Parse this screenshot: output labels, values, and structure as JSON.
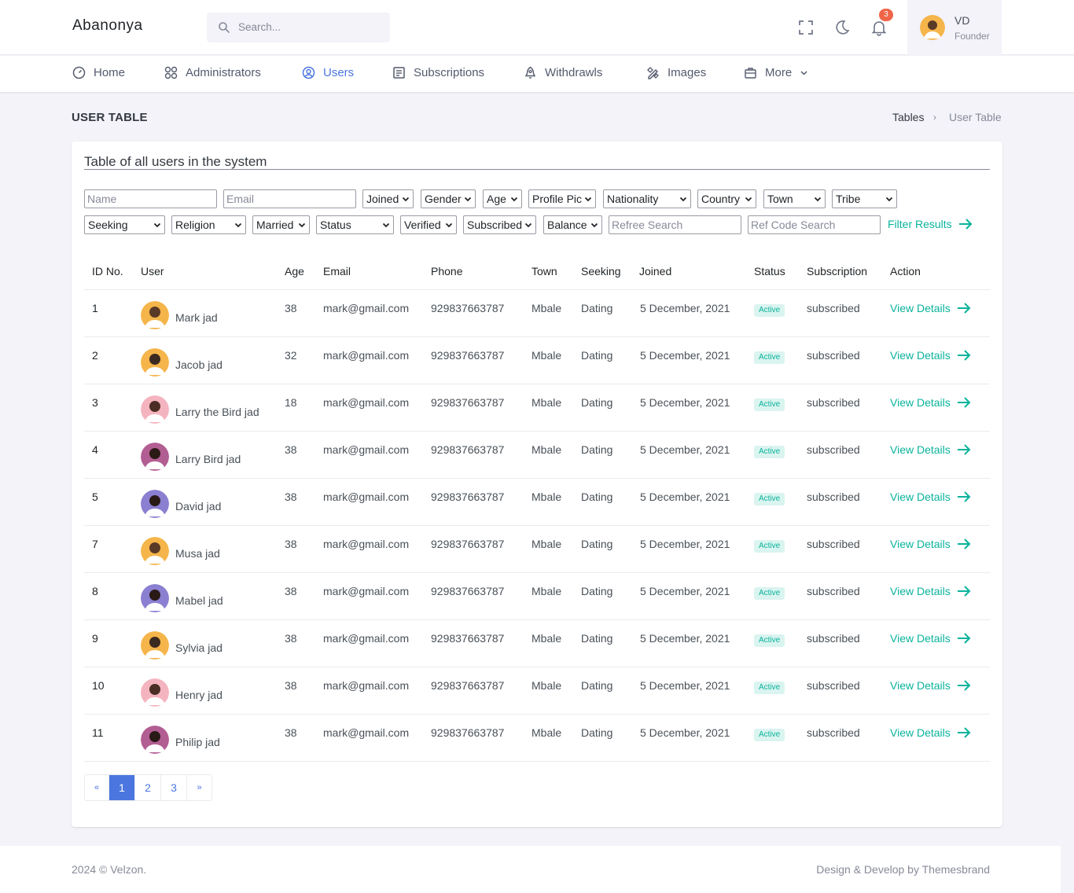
{
  "header": {
    "brand": "Abanonya",
    "search_placeholder": "Search...",
    "notifications_count": "3",
    "user": {
      "initials": "VD",
      "role": "Founder"
    }
  },
  "nav": [
    {
      "label": "Home",
      "icon": "dashboard-icon"
    },
    {
      "label": "Administrators",
      "icon": "apps-icon"
    },
    {
      "label": "Users",
      "icon": "user-circle-icon",
      "active": true
    },
    {
      "label": "Subscriptions",
      "icon": "file-list-icon"
    },
    {
      "label": "Withdrawls",
      "icon": "rocket-icon"
    },
    {
      "label": "Images",
      "icon": "pencil-ruler-icon"
    },
    {
      "label": "More",
      "icon": "briefcase-icon"
    }
  ],
  "page": {
    "title": "USER TABLE",
    "breadcrumb": [
      "Tables",
      "User Table"
    ]
  },
  "card": {
    "title": "Table of all users in the system",
    "filters": {
      "name_placeholder": "Name",
      "email_placeholder": "Email",
      "row1_selects": [
        "Joined",
        "Gender",
        "Age",
        "Profile Pic",
        "Nationality",
        "Country",
        "Town",
        "Tribe"
      ],
      "row2_selects": [
        "Seeking",
        "Religion",
        "Married",
        "Status",
        "Verified",
        "Subscribed",
        "Balance"
      ],
      "refree_placeholder": "Refree Search",
      "refcode_placeholder": "Ref Code Search",
      "filter_button": "Filter Results"
    },
    "columns": [
      "ID No.",
      "User",
      "Age",
      "Email",
      "Phone",
      "Town",
      "Seeking",
      "Joined",
      "Status",
      "Subscription",
      "Action"
    ],
    "rows": [
      {
        "id": "1",
        "name": "Mark jad",
        "age": "38",
        "email": "mark@gmail.com",
        "phone": "929837663787",
        "town": "Mbale",
        "seeking": "Dating",
        "joined": "5 December, 2021",
        "status": "Active",
        "subscription": "subscribed",
        "action": "View Details"
      },
      {
        "id": "2",
        "name": "Jacob jad",
        "age": "32",
        "email": "mark@gmail.com",
        "phone": "929837663787",
        "town": "Mbale",
        "seeking": "Dating",
        "joined": "5 December, 2021",
        "status": "Active",
        "subscription": "subscribed",
        "action": "View Details"
      },
      {
        "id": "3",
        "name": "Larry the Bird jad",
        "age": "18",
        "email": "mark@gmail.com",
        "phone": "929837663787",
        "town": "Mbale",
        "seeking": "Dating",
        "joined": "5 December, 2021",
        "status": "Active",
        "subscription": "subscribed",
        "action": "View Details"
      },
      {
        "id": "4",
        "name": "Larry Bird jad",
        "age": "38",
        "email": "mark@gmail.com",
        "phone": "929837663787",
        "town": "Mbale",
        "seeking": "Dating",
        "joined": "5 December, 2021",
        "status": "Active",
        "subscription": "subscribed",
        "action": "View Details"
      },
      {
        "id": "5",
        "name": "David jad",
        "age": "38",
        "email": "mark@gmail.com",
        "phone": "929837663787",
        "town": "Mbale",
        "seeking": "Dating",
        "joined": "5 December, 2021",
        "status": "Active",
        "subscription": "subscribed",
        "action": "View Details"
      },
      {
        "id": "7",
        "name": "Musa jad",
        "age": "38",
        "email": "mark@gmail.com",
        "phone": "929837663787",
        "town": "Mbale",
        "seeking": "Dating",
        "joined": "5 December, 2021",
        "status": "Active",
        "subscription": "subscribed",
        "action": "View Details"
      },
      {
        "id": "8",
        "name": "Mabel jad",
        "age": "38",
        "email": "mark@gmail.com",
        "phone": "929837663787",
        "town": "Mbale",
        "seeking": "Dating",
        "joined": "5 December, 2021",
        "status": "Active",
        "subscription": "subscribed",
        "action": "View Details"
      },
      {
        "id": "9",
        "name": "Sylvia jad",
        "age": "38",
        "email": "mark@gmail.com",
        "phone": "929837663787",
        "town": "Mbale",
        "seeking": "Dating",
        "joined": "5 December, 2021",
        "status": "Active",
        "subscription": "subscribed",
        "action": "View Details"
      },
      {
        "id": "10",
        "name": "Henry jad",
        "age": "38",
        "email": "mark@gmail.com",
        "phone": "929837663787",
        "town": "Mbale",
        "seeking": "Dating",
        "joined": "5 December, 2021",
        "status": "Active",
        "subscription": "subscribed",
        "action": "View Details"
      },
      {
        "id": "11",
        "name": "Philip jad",
        "age": "38",
        "email": "mark@gmail.com",
        "phone": "929837663787",
        "town": "Mbale",
        "seeking": "Dating",
        "joined": "5 December, 2021",
        "status": "Active",
        "subscription": "subscribed",
        "action": "View Details"
      }
    ],
    "pagination": {
      "prev": "«",
      "pages": [
        "1",
        "2",
        "3"
      ],
      "next": "»",
      "current": "1"
    }
  },
  "footer": {
    "left": "2024 © Velzon.",
    "right": "Design & Develop by Themesbrand"
  },
  "colors": {
    "accent": "#4b76e0",
    "success": "#0ab39c",
    "danger": "#f06548"
  }
}
